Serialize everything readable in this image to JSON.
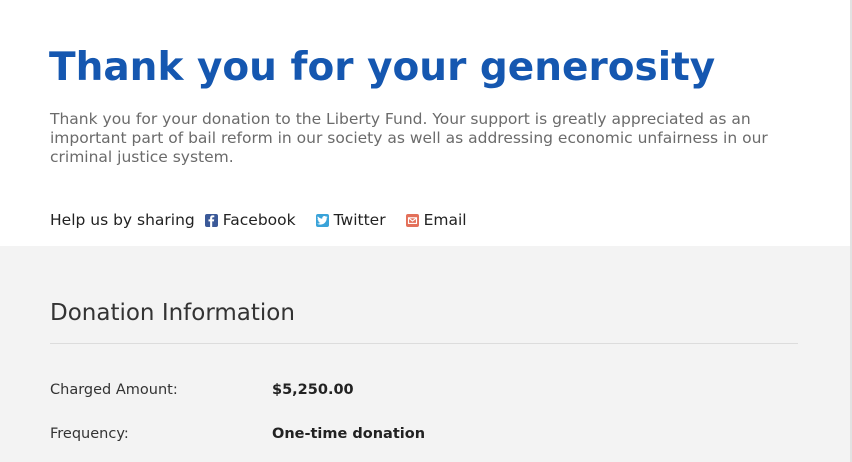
{
  "hero": {
    "title": "Thank you for your generosity",
    "message": "Thank you for your donation to the Liberty Fund. Your support is greatly appreciated as an important part of bail reform in our society as well as addressing economic unfairness in our criminal justice system."
  },
  "share": {
    "label": "Help us by sharing",
    "links": [
      {
        "label": "Facebook",
        "icon": "facebook-icon",
        "color": "#3b5998"
      },
      {
        "label": "Twitter",
        "icon": "twitter-icon",
        "color": "#3aa3d9"
      },
      {
        "label": "Email",
        "icon": "email-icon",
        "color": "#e3705a"
      }
    ]
  },
  "donation": {
    "title": "Donation Information",
    "rows": [
      {
        "label": "Charged Amount:",
        "value": "$5,250.00"
      },
      {
        "label": "Frequency:",
        "value": "One-time donation"
      }
    ]
  },
  "colors": {
    "title_blue": "#1557b0",
    "details_background": "#f3f3f3"
  }
}
